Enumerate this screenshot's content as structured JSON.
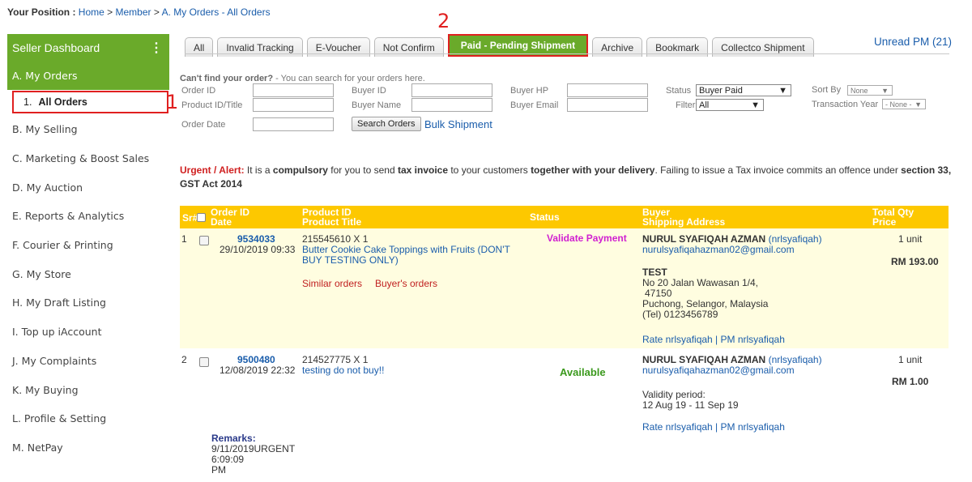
{
  "breadcrumb": {
    "label": "Your Position :",
    "home": "Home",
    "sep": ">",
    "member": "Member",
    "current": "A. My Orders - All Orders"
  },
  "sidebar": {
    "title": "Seller Dashboard",
    "kebab": "⋮",
    "items": [
      "A. My Orders",
      "B. My Selling",
      "C. Marketing & Boost Sales",
      "D. My Auction",
      "E. Reports & Analytics",
      "F. Courier & Printing",
      "G. My Store",
      "H. My Draft Listing",
      "I. Top up iAccount",
      "J. My Complaints",
      "K. My Buying",
      "L. Profile & Setting",
      "M. NetPay"
    ],
    "sub_number": "1.",
    "sub_label": "All Orders"
  },
  "callouts": {
    "one": "1",
    "two": "2"
  },
  "tabs": [
    "All",
    "Invalid Tracking",
    "E-Voucher",
    "Not Confirm",
    "Paid - Pending Shipment",
    "Archive",
    "Bookmark",
    "Collectco Shipment"
  ],
  "unread": "Unread PM (21)",
  "search": {
    "hint_bold": "Can't find your order?",
    "hint_rest": " - You can search for your orders here.",
    "order_id": "Order ID",
    "product": "Product ID/Title",
    "order_date": "Order Date",
    "buyer_id": "Buyer ID",
    "buyer_name": "Buyer Name",
    "buyer_hp": "Buyer HP",
    "buyer_email": "Buyer Email",
    "status_label": "Status",
    "status_value": "Buyer Paid",
    "filter_label": "Filter",
    "filter_value": "All",
    "sort_label": "Sort By",
    "sort_value": "None",
    "year_label": "Transaction Year",
    "year_value": "- None -",
    "search_button": "Search Orders",
    "bulk": "Bulk Shipment",
    "dropdown_arrow": "▼"
  },
  "alert": {
    "prefix": "Urgent / Alert:",
    "t1": " It is a ",
    "b1": "compulsory",
    "t2": " for you to send ",
    "b2": "tax invoice",
    "t3": " to your customers ",
    "b3": "together with your delivery",
    "t4": ". Failing to issue a Tax invoice commits an offence under ",
    "b4": "section 33, GST Act 2014"
  },
  "table": {
    "headers": {
      "sr": "Sr#",
      "order_id": "Order ID",
      "date": "Date",
      "product_id": "Product ID",
      "product_title": "Product Title",
      "status": "Status",
      "buyer": "Buyer",
      "address": "Shipping Address",
      "qty": "Total Qty",
      "price": "Price"
    },
    "rows": [
      {
        "sr": "1",
        "order_id": "9534033",
        "date": "29/10/2019 09:33",
        "product_id": "215545610 X 1",
        "title_1": "Butter Cookie Cake Toppings with Fruits (DON'T",
        "title_2": "BUY TESTING ONLY)",
        "similar": "Similar orders",
        "buyers_orders": "Buyer's orders",
        "status": "Validate Payment",
        "buyer_name": "NURUL SYAFIQAH AZMAN",
        "buyer_handle": "(nrlsyafiqah)",
        "email": "nurulsyafiqahazman02@gmail.com",
        "addr_title": "TEST",
        "addr_1": "No 20 Jalan Wawasan 1/4,",
        "addr_2": "47150",
        "addr_3": "Puchong,  Selangor,  Malaysia",
        "addr_4": "(Tel) 0123456789",
        "rate": "Rate nrlsyafiqah | PM nrlsyafiqah",
        "qty": "1 unit",
        "price": "RM 193.00"
      },
      {
        "sr": "2",
        "order_id": "9500480",
        "date": "12/08/2019 22:32",
        "product_id": "214527775 X 1",
        "title_1": "testing do not buy!!",
        "status": "Available",
        "buyer_name": "NURUL SYAFIQAH AZMAN",
        "buyer_handle": "(nrlsyafiqah)",
        "email": "nurulsyafiqahazman02@gmail.com",
        "validity_label": "Validity period:",
        "validity": "12 Aug 19 - 11 Sep 19",
        "rate": "Rate nrlsyafiqah | PM nrlsyafiqah",
        "qty": "1 unit",
        "price": "RM 1.00",
        "remarks_label": "Remarks:",
        "remarks_1": "9/11/2019URGENT",
        "remarks_2": "6:09:09",
        "remarks_3": "PM"
      }
    ]
  },
  "colors": {
    "green": "#6aaa2a",
    "header_yellow": "#fdc800",
    "row_highlight": "#fffde0",
    "link_blue": "#1a5dab",
    "callout_red": "#e02020",
    "status_magenta": "#d020d0",
    "status_green": "#3c9a1e"
  }
}
